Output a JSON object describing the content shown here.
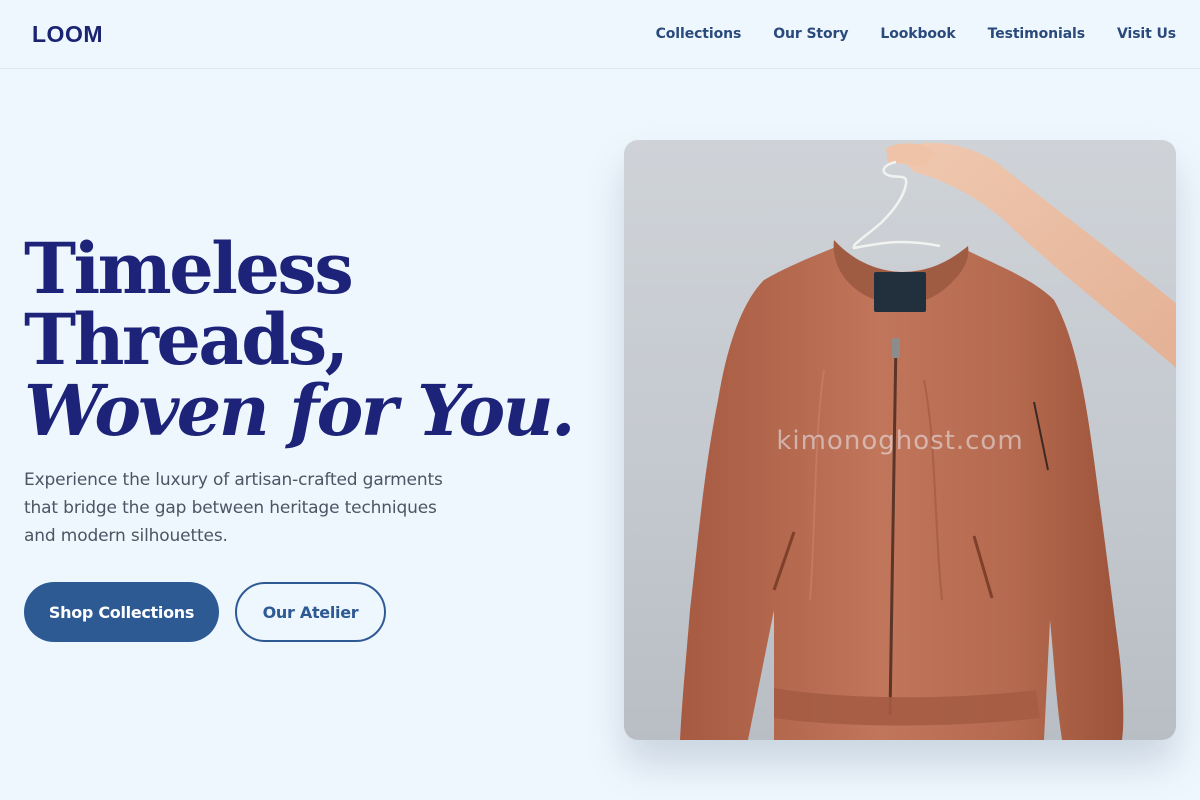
{
  "brand": {
    "name": "LOOM"
  },
  "nav": {
    "items": [
      {
        "label": "Collections"
      },
      {
        "label": "Our Story"
      },
      {
        "label": "Lookbook"
      },
      {
        "label": "Testimonials"
      },
      {
        "label": "Visit Us"
      }
    ]
  },
  "hero": {
    "headline_line1": "Timeless",
    "headline_line2": "Threads,",
    "headline_line3": "Woven for You.",
    "subtitle": "Experience the luxury of artisan-crafted garments that bridge the gap between heritage techniques and modern silhouettes.",
    "primary_button": "Shop Collections",
    "secondary_button": "Our Atelier"
  },
  "image": {
    "subject": "jacket-on-hanger-photo",
    "watermark": "kimonoghost.com"
  },
  "colors": {
    "background": "#eff7fe",
    "brand": "#1b2470",
    "accent": "#2e5a94",
    "body_text": "#4b5563",
    "jacket": "#b8694f"
  }
}
